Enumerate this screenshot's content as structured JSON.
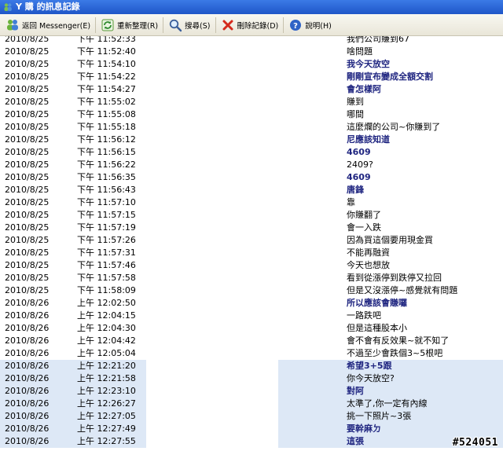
{
  "window": {
    "title": "Y 購 的訊息記錄"
  },
  "toolbar": {
    "back_label": "返回 Messenger(E)",
    "refresh_label": "重新整理(R)",
    "search_label": "搜尋(S)",
    "delete_label": "刪除記錄(D)",
    "help_label": "說明(H)"
  },
  "rows": [
    {
      "date": "2010/8/25",
      "time": "下午 11:52:33",
      "msg": "我們公司賺到67",
      "bold": false,
      "selected": false
    },
    {
      "date": "2010/8/25",
      "time": "下午 11:52:40",
      "msg": "啥問題",
      "bold": false,
      "selected": false
    },
    {
      "date": "2010/8/25",
      "time": "下午 11:54:10",
      "msg": "我今天放空",
      "bold": true,
      "selected": false
    },
    {
      "date": "2010/8/25",
      "time": "下午 11:54:22",
      "msg": "剛剛宣布變成全額交割",
      "bold": true,
      "selected": false
    },
    {
      "date": "2010/8/25",
      "time": "下午 11:54:27",
      "msg": "會怎樣阿",
      "bold": true,
      "selected": false
    },
    {
      "date": "2010/8/25",
      "time": "下午 11:55:02",
      "msg": "賺到",
      "bold": false,
      "selected": false
    },
    {
      "date": "2010/8/25",
      "time": "下午 11:55:08",
      "msg": "哪間",
      "bold": false,
      "selected": false
    },
    {
      "date": "2010/8/25",
      "time": "下午 11:55:18",
      "msg": "這麼爛的公司~你賺到了",
      "bold": false,
      "selected": false
    },
    {
      "date": "2010/8/25",
      "time": "下午 11:56:12",
      "msg": "尼應該知道",
      "bold": true,
      "selected": false
    },
    {
      "date": "2010/8/25",
      "time": "下午 11:56:15",
      "msg": "4609",
      "bold": true,
      "selected": false
    },
    {
      "date": "2010/8/25",
      "time": "下午 11:56:22",
      "msg": "2409?",
      "bold": false,
      "selected": false
    },
    {
      "date": "2010/8/25",
      "time": "下午 11:56:35",
      "msg": "4609",
      "bold": true,
      "selected": false
    },
    {
      "date": "2010/8/25",
      "time": "下午 11:56:43",
      "msg": "唐鋒",
      "bold": true,
      "selected": false
    },
    {
      "date": "2010/8/25",
      "time": "下午 11:57:10",
      "msg": "靠",
      "bold": false,
      "selected": false
    },
    {
      "date": "2010/8/25",
      "time": "下午 11:57:15",
      "msg": "你賺翻了",
      "bold": false,
      "selected": false
    },
    {
      "date": "2010/8/25",
      "time": "下午 11:57:19",
      "msg": "會一入跌",
      "bold": false,
      "selected": false
    },
    {
      "date": "2010/8/25",
      "time": "下午 11:57:26",
      "msg": "因為買這個要用現金買",
      "bold": false,
      "selected": false
    },
    {
      "date": "2010/8/25",
      "time": "下午 11:57:31",
      "msg": "不能再融資",
      "bold": false,
      "selected": false
    },
    {
      "date": "2010/8/25",
      "time": "下午 11:57:46",
      "msg": "今天也想放",
      "bold": false,
      "selected": false
    },
    {
      "date": "2010/8/25",
      "time": "下午 11:57:58",
      "msg": "看到從漲停到跌停又拉回",
      "bold": false,
      "selected": false
    },
    {
      "date": "2010/8/25",
      "time": "下午 11:58:09",
      "msg": "但是又沒漲停~感覺就有問題",
      "bold": false,
      "selected": false
    },
    {
      "date": "2010/8/26",
      "time": "上午 12:02:50",
      "msg": "所以應該會賺囉",
      "bold": true,
      "selected": false
    },
    {
      "date": "2010/8/26",
      "time": "上午 12:04:15",
      "msg": "一路跌吧",
      "bold": false,
      "selected": false
    },
    {
      "date": "2010/8/26",
      "time": "上午 12:04:30",
      "msg": "但是這種股本小",
      "bold": false,
      "selected": false
    },
    {
      "date": "2010/8/26",
      "time": "上午 12:04:42",
      "msg": "會不會有反效果~就不知了",
      "bold": false,
      "selected": false
    },
    {
      "date": "2010/8/26",
      "time": "上午 12:05:04",
      "msg": "不過至少會跌個3~5根吧",
      "bold": false,
      "selected": false
    },
    {
      "date": "2010/8/26",
      "time": "上午 12:21:20",
      "msg": "希望3+5跟",
      "bold": true,
      "selected": true
    },
    {
      "date": "2010/8/26",
      "time": "上午 12:21:58",
      "msg": "你今天放空?",
      "bold": false,
      "selected": true
    },
    {
      "date": "2010/8/26",
      "time": "上午 12:23:10",
      "msg": "對阿",
      "bold": true,
      "selected": true
    },
    {
      "date": "2010/8/26",
      "time": "上午 12:26:27",
      "msg": "太準了,你一定有內線",
      "bold": false,
      "selected": true
    },
    {
      "date": "2010/8/26",
      "time": "上午 12:27:05",
      "msg": "挑一下照片~3張",
      "bold": false,
      "selected": true
    },
    {
      "date": "2010/8/26",
      "time": "上午 12:27:49",
      "msg": "要幹麻ㄉ",
      "bold": true,
      "selected": true
    },
    {
      "date": "2010/8/26",
      "time": "上午 12:27:55",
      "msg": "這張",
      "bold": true,
      "selected": true
    }
  ],
  "watermark": "#524051"
}
